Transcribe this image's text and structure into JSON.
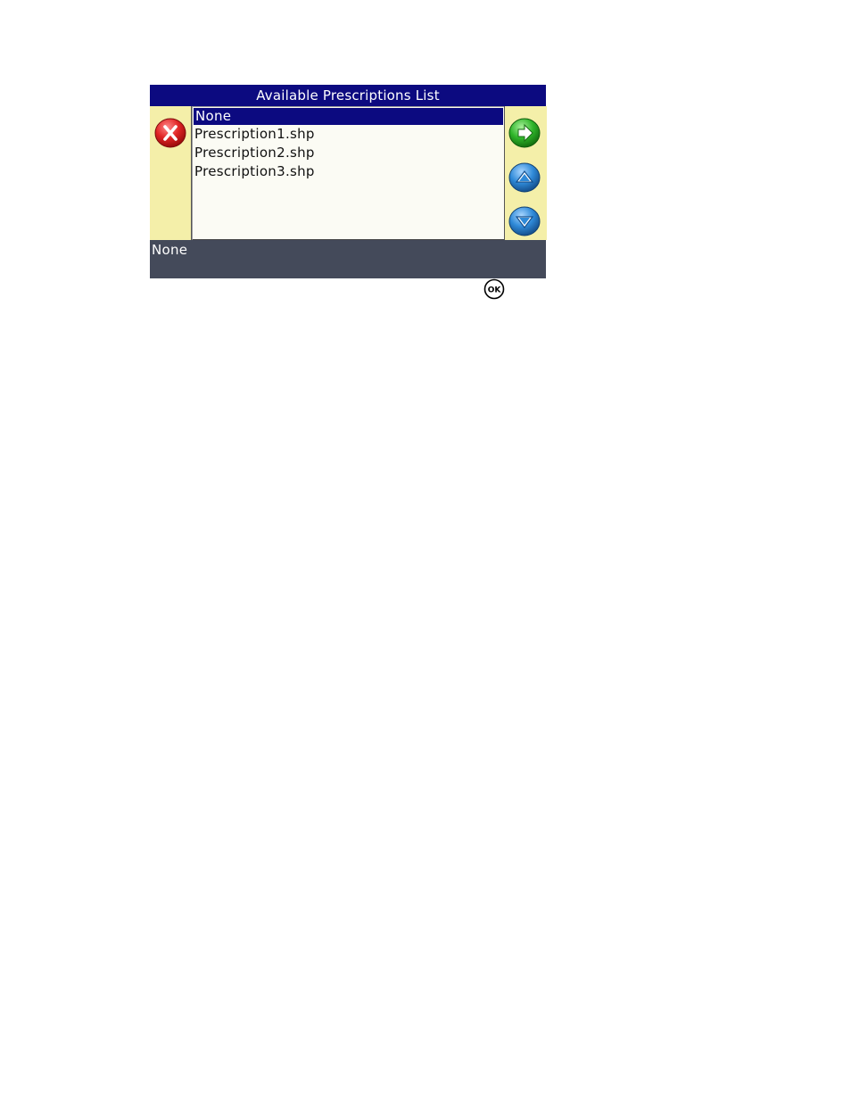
{
  "dialog": {
    "title": "Available Prescriptions List",
    "items": [
      {
        "label": "None",
        "selected": true
      },
      {
        "label": "Prescription1.shp",
        "selected": false
      },
      {
        "label": "Prescription2.shp",
        "selected": false
      },
      {
        "label": "Prescription3.shp",
        "selected": false
      }
    ],
    "status": "None"
  },
  "buttons": {
    "close": {
      "icon": "close-x-icon",
      "color": "#d81e1e"
    },
    "next": {
      "icon": "arrow-right-icon",
      "color": "#2fb52a"
    },
    "up": {
      "icon": "arrow-up-icon",
      "color": "#2f8ad8"
    },
    "down": {
      "icon": "arrow-down-icon",
      "color": "#2f8ad8"
    }
  },
  "ok_key": {
    "label": "OK"
  },
  "colors": {
    "title_bg": "#0c0a80",
    "panel_bg": "#f4efa9",
    "list_bg": "#fbfbf4",
    "status_bg": "#444a5a"
  }
}
